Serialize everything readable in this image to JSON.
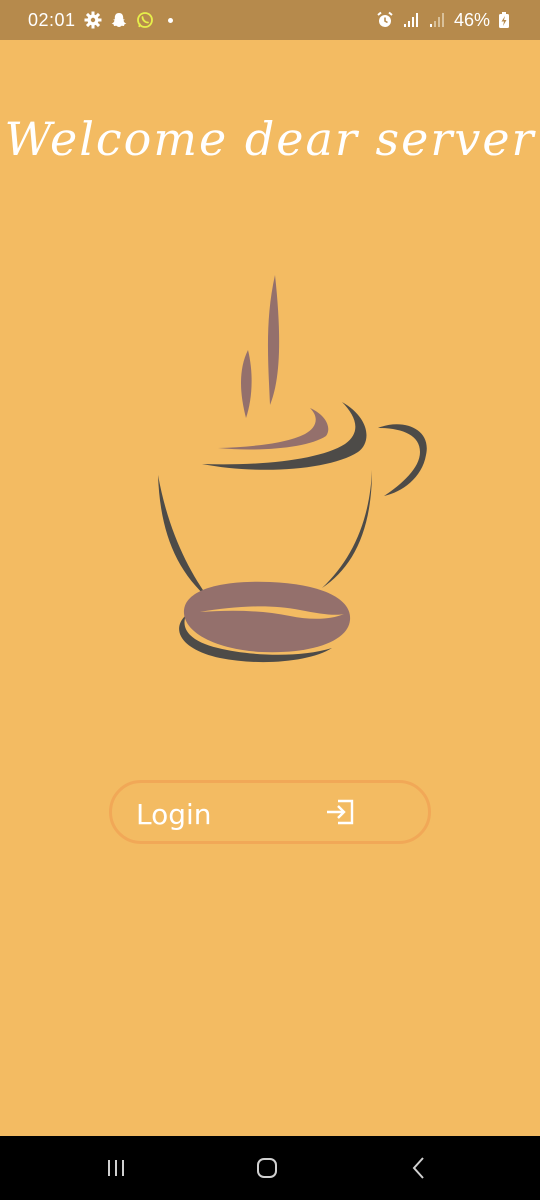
{
  "status_bar": {
    "time": "02:01",
    "battery_percent": "46%",
    "icons": [
      "settings-icon",
      "snapchat-icon",
      "whatsapp-icon",
      "notification-dot",
      "alarm-icon",
      "signal-icon",
      "signal-icon-2",
      "battery-icon"
    ]
  },
  "screen": {
    "title": "Welcome dear server",
    "logo": "coffee-cup-bean-logo",
    "login_button": {
      "label": "Login",
      "icon": "login-icon"
    }
  },
  "nav_bar": {
    "buttons": [
      "recent-apps",
      "home",
      "back"
    ]
  },
  "colors": {
    "background": "#f3bb62",
    "status_bar": "#b68a4c",
    "button_border": "#f1a857",
    "cup_stroke": "#4d4b48",
    "bean_fill": "#94706c",
    "text": "#ffffff"
  }
}
